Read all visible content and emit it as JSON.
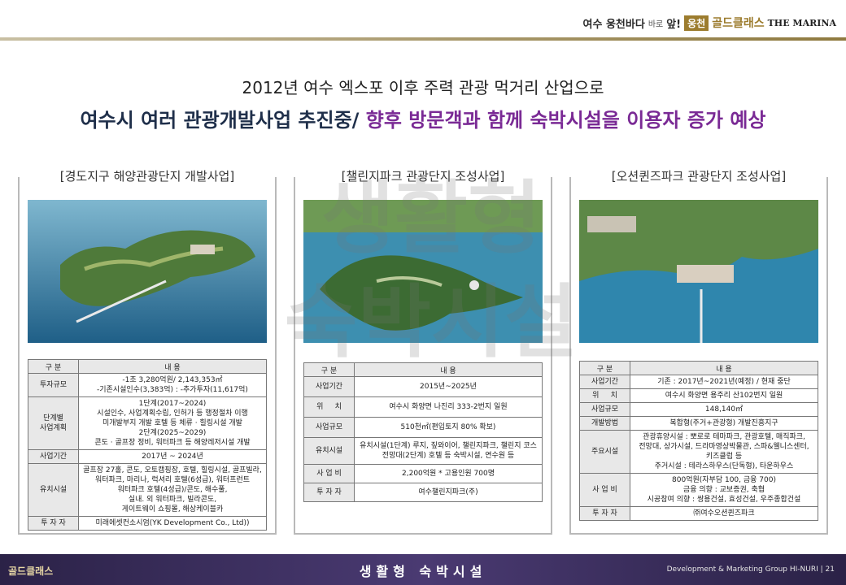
{
  "brand": {
    "prefix": "여수 웅천바다",
    "small": "바로",
    "mid": "앞!",
    "tag": "웅천",
    "name": "골드클래스",
    "marina": "THE MARINA"
  },
  "headline": "2012년 여수 엑스포 이후 주력 관광 먹거리 산업으로",
  "subhead": {
    "part1": "여수시 여러 관광개발사업 추진중/",
    "part2": "향후 방문객과 함께 숙박시설을 이용자 증가 예상"
  },
  "watermark": {
    "line1": "생활형",
    "line2": "숙박시설"
  },
  "projects": [
    {
      "title": "[경도지구 해양관광단지 개발사업]",
      "header": [
        "구 분",
        "내 용"
      ],
      "rows": [
        {
          "k": "투자규모",
          "v": "-1조 3,280억원/ 2,143,353㎡\n-기존시설인수(3,383억) : -추가투자(11,617억)"
        },
        {
          "k": "단계별\n사업계획",
          "v": "1단계(2017~2024)\n시설인수, 사업계획수립, 인허가 등 행정절차 이행\n미개발부지 개발 호텔 등 체류 · 힐링시설 개발\n2단계(2025~2029)\n콘도 · 골프장 정비, 워터파크 등 해양레저시설 개발"
        },
        {
          "k": "사업기간",
          "v": "2017년 ~ 2024년"
        },
        {
          "k": "유치시설",
          "v": "골프장 27홀, 콘도, 오토캠핑장, 호텔, 힐링시설, 골프빌라,\n워터파크, 마리나, 럭셔리 호텔(6성급), 워터프런트\n워터파크 호텔(4성급)/콘도, 해수풀,\n실내. 외 워터파크, 빌라콘도,\n게이트웨이 쇼핑몰, 해상케이블카"
        },
        {
          "k": "투 자 자",
          "v": "미래에셋컨소시엄(YK Development Co., Ltd))"
        }
      ]
    },
    {
      "title": "[챌린지파크 관광단지 조성사업]",
      "header": [
        "구 분",
        "내 용"
      ],
      "rows": [
        {
          "k": "사업기간",
          "v": "2015년~2025년"
        },
        {
          "k": "위     치",
          "v": "여수시 화양면 나진리 333-2번지 일원"
        },
        {
          "k": "사업규모",
          "v": "510천㎡(편입토지 80% 확보)"
        },
        {
          "k": "유치시설",
          "v": "유치시설(1단계) 루지, 짚와이어, 챌린지파크, 챌린지 코스\n전망대(2단계) 호텔 등 숙박시설, 연수원 등"
        },
        {
          "k": "사 업 비",
          "v": "2,200억원 * 고용인원 700명"
        },
        {
          "k": "투 자 자",
          "v": "여수챌린지파크(주)"
        }
      ]
    },
    {
      "title": "[오션퀸즈파크 관광단지 조성사업]",
      "header": [
        "구 분",
        "내 용"
      ],
      "rows": [
        {
          "k": "사업기간",
          "v": "기존 : 2017년~2021년(예정) / 현재 중단"
        },
        {
          "k": "위     치",
          "v": "여수시 화양면 용주리 산102번지 일원"
        },
        {
          "k": "사업규모",
          "v": "148,140㎡"
        },
        {
          "k": "개발방법",
          "v": "복합형(주거+관광형) 개발진흥지구"
        },
        {
          "k": "주요시설",
          "v": "관광휴양시설 : 뽀로로 테마파크, 관광호텔, 매직파크,\n전망대, 상가시설, 드라마영상박물관, 스파&웰니스센터,\n키즈클럽 등\n주거시설 : 테라스하우스(단독형), 타운하우스"
        },
        {
          "k": "사 업 비",
          "v": "800억원(자부담 100, 금융 700)\n금융 의향 : 교보증권, 축협\n시공참여 의향 : 쌍용건설, 효성건설, 우주종합건설"
        },
        {
          "k": "투 자 자",
          "v": "㈜여수오션퀸즈파크"
        }
      ]
    }
  ],
  "footer": {
    "logo": "골드클래스",
    "center": "생활형 숙박시설",
    "right": "Development & Marketing Group HI-NURI  |  21"
  }
}
